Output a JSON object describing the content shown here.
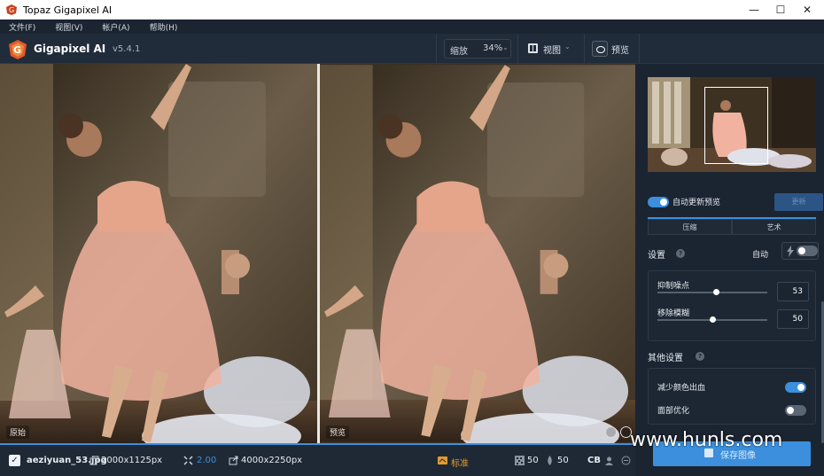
{
  "window": {
    "title": "Topaz Gigapixel AI"
  },
  "menu": [
    "文件(F)",
    "视图(V)",
    "帐户(A)",
    "帮助(H)"
  ],
  "toolbar": {
    "app_name": "Gigapixel AI",
    "version": "v5.4.1",
    "zoom_label": "缩放",
    "zoom_value": "34%",
    "view_label": "视图",
    "preview_label": "预览"
  },
  "canvas": {
    "original_label": "原始",
    "preview_label": "预览"
  },
  "status": {
    "filename": "aeziyuan_53.jpg",
    "input_size": "2000x1125px",
    "scale": "2.00",
    "output_size": "4000x2250px",
    "model": "标准",
    "noise": "50",
    "blur": "50",
    "color_mode": "CB"
  },
  "panel": {
    "auto_update_label": "自动更新预览",
    "update_button": "更新",
    "modes": [
      "压缩",
      "艺术"
    ],
    "settings_label": "设置",
    "auto_label": "自动",
    "sliders": [
      {
        "label": "抑制噪点",
        "value": "53",
        "fraction": 0.53
      },
      {
        "label": "移除模糊",
        "value": "50",
        "fraction": 0.5
      }
    ],
    "other_label": "其他设置",
    "options": [
      {
        "label": "减少颜色出血",
        "on": true
      },
      {
        "label": "面部优化",
        "on": false
      }
    ],
    "save_button": "保存图像"
  },
  "watermark": "www.hunls.com",
  "colors": {
    "accent": "#3b8fdc",
    "model_badge": "#e39a2f",
    "background": "#1b2431"
  }
}
